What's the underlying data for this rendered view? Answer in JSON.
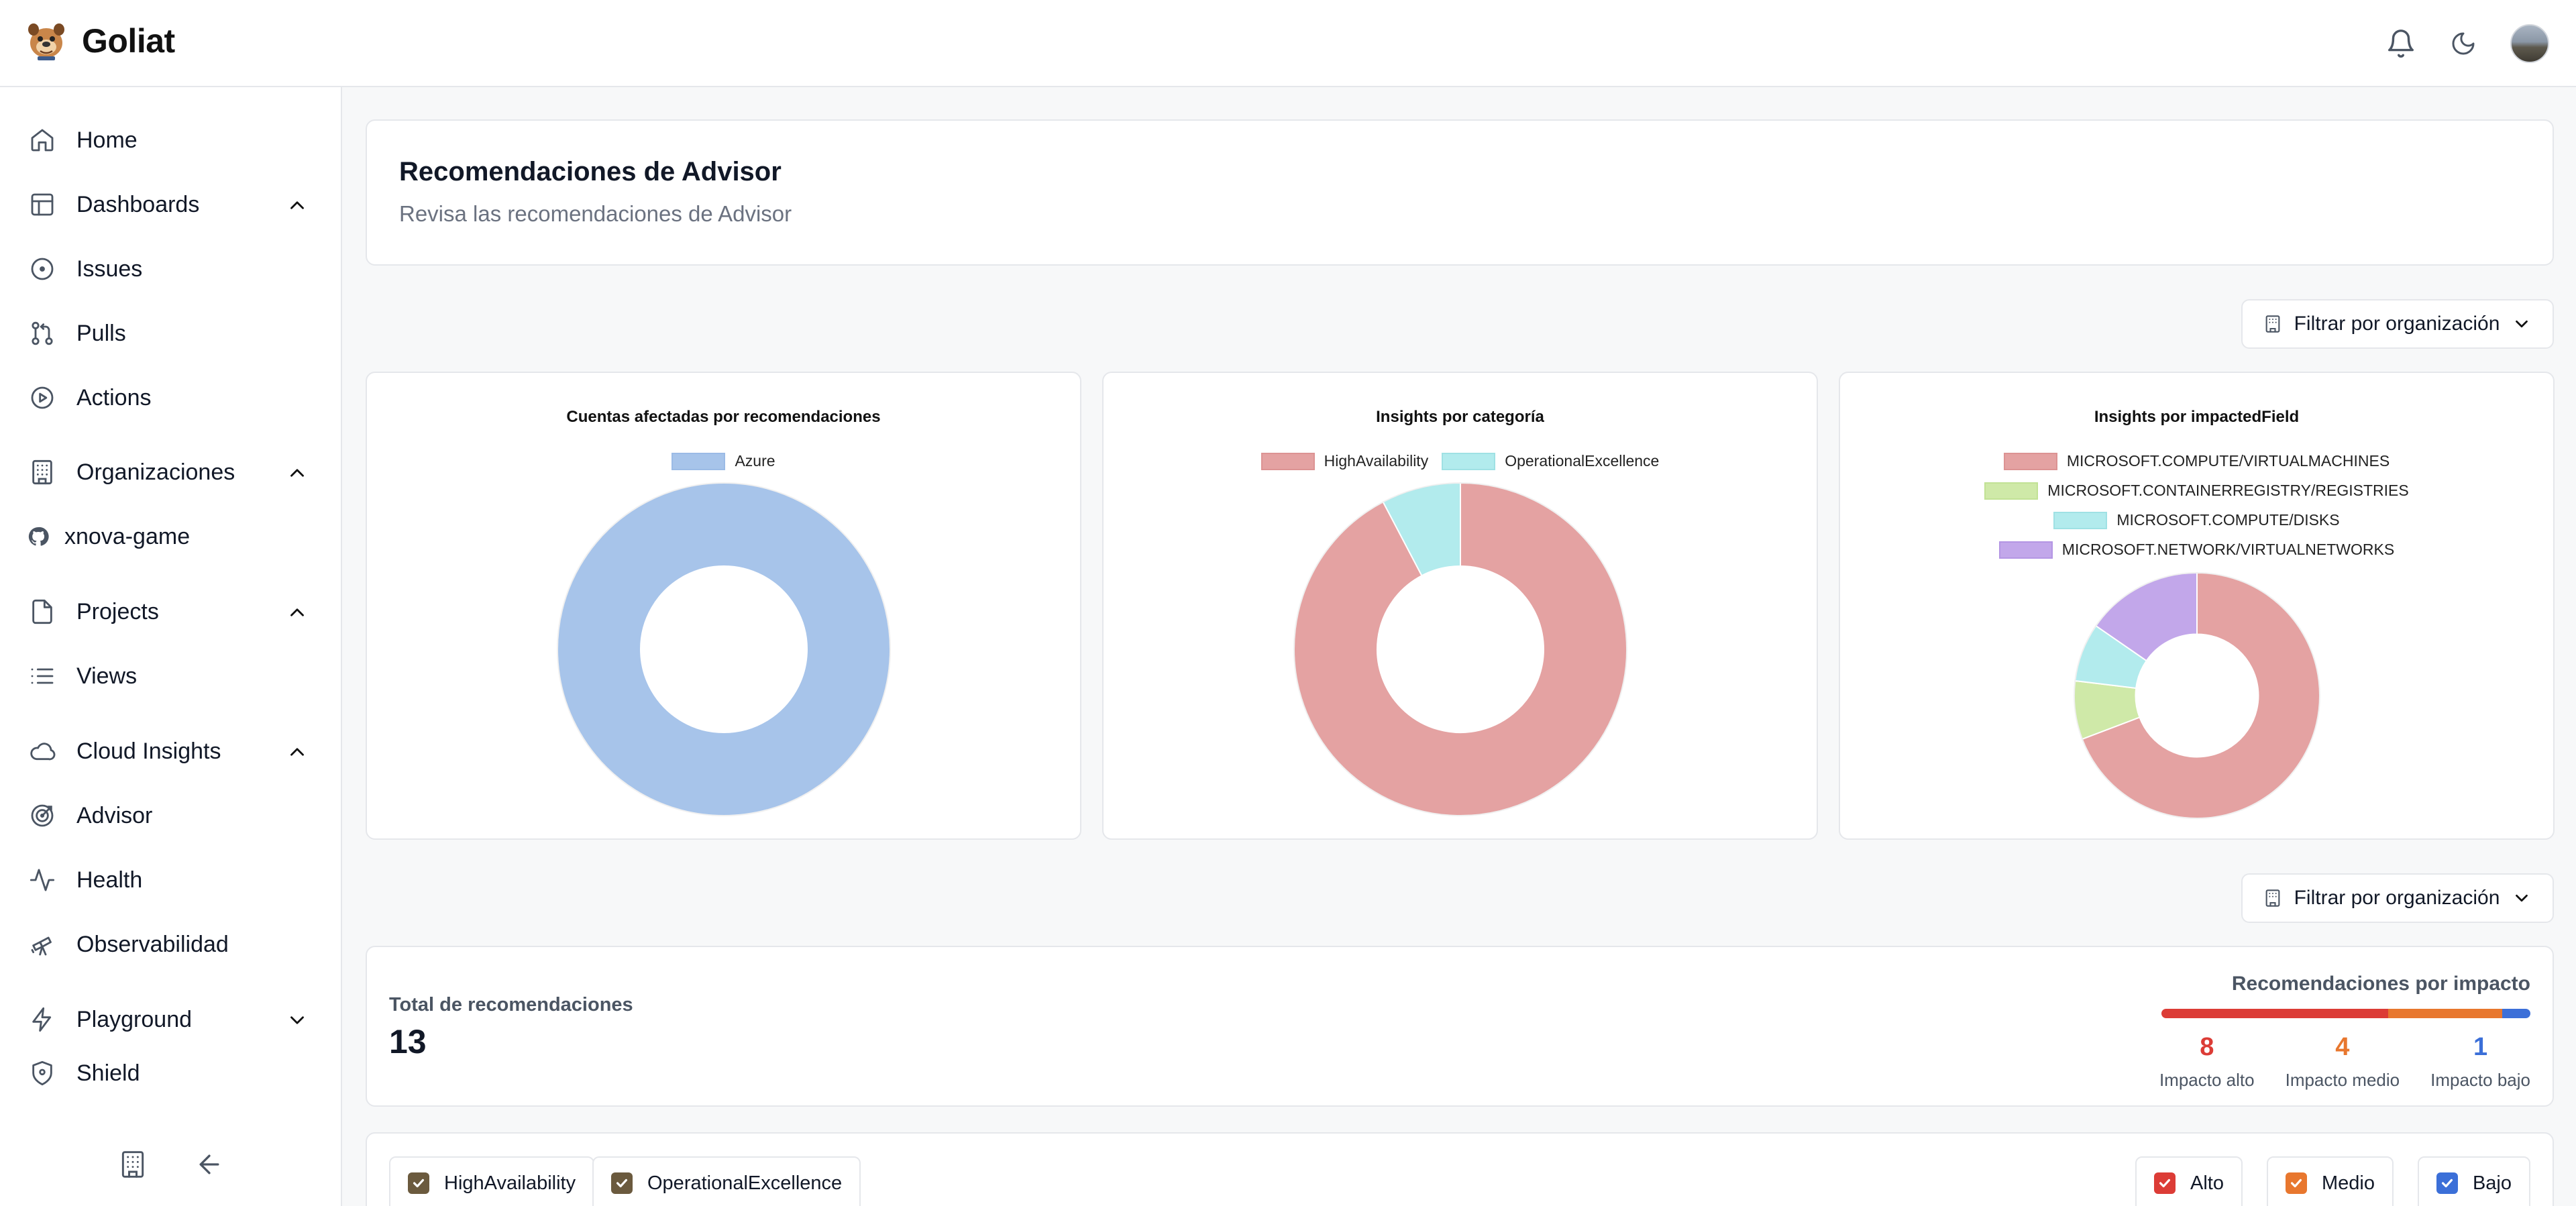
{
  "app": {
    "name": "Goliat"
  },
  "sidebar": {
    "items": [
      {
        "label": "Home",
        "icon": "home-icon"
      },
      {
        "label": "Dashboards",
        "icon": "table-layout-icon"
      },
      {
        "label": "Issues",
        "icon": "circle-dot-icon"
      },
      {
        "label": "Pulls",
        "icon": "git-pull-request-icon"
      },
      {
        "label": "Actions",
        "icon": "play-circle-icon"
      },
      {
        "label": "Organizaciones",
        "icon": "building-icon"
      },
      {
        "label": "xnova-game",
        "icon": "github-icon"
      },
      {
        "label": "Projects",
        "icon": "file-icon"
      },
      {
        "label": "Views",
        "icon": "list-icon"
      },
      {
        "label": "Cloud Insights",
        "icon": "cloud-icon"
      },
      {
        "label": "Advisor",
        "icon": "target-icon"
      },
      {
        "label": "Health",
        "icon": "activity-icon"
      },
      {
        "label": "Observabilidad",
        "icon": "telescope-icon"
      },
      {
        "label": "Playground",
        "icon": "zap-icon"
      },
      {
        "label": "Shield",
        "icon": "shield-icon"
      }
    ]
  },
  "header": {
    "title": "Recomendaciones de Advisor",
    "subtitle": "Revisa las recomendaciones de Advisor"
  },
  "filter": {
    "label": "Filtrar por organización"
  },
  "charts": {
    "cuentas": {
      "title": "Cuentas afectadas por recomendaciones",
      "legend": [
        "Azure"
      ]
    },
    "categoria": {
      "title": "Insights por categoría",
      "legend": [
        "HighAvailability",
        "OperationalExcellence"
      ]
    },
    "impacted": {
      "title": "Insights por impactedField",
      "legend": [
        "MICROSOFT.COMPUTE/VIRTUALMACHINES",
        "MICROSOFT.CONTAINERREGISTRY/REGISTRIES",
        "MICROSOFT.COMPUTE/DISKS",
        "MICROSOFT.NETWORK/VIRTUALNETWORKS"
      ]
    }
  },
  "chart_data": [
    {
      "type": "pie",
      "title": "Cuentas afectadas por recomendaciones",
      "categories": [
        "Azure"
      ],
      "values": [
        13
      ],
      "colors": [
        "#a7c4ea"
      ],
      "legend": "top"
    },
    {
      "type": "pie",
      "title": "Insights por categoría",
      "categories": [
        "HighAvailability",
        "OperationalExcellence"
      ],
      "values": [
        12,
        1
      ],
      "colors": [
        "#e4a2a2",
        "#b2ebed"
      ],
      "legend": "top"
    },
    {
      "type": "pie",
      "title": "Insights por impactedField",
      "categories": [
        "MICROSOFT.COMPUTE/VIRTUALMACHINES",
        "MICROSOFT.CONTAINERREGISTRY/REGISTRIES",
        "MICROSOFT.COMPUTE/DISKS",
        "MICROSOFT.NETWORK/VIRTUALNETWORKS"
      ],
      "values": [
        9,
        1,
        1,
        2
      ],
      "colors": [
        "#e4a2a2",
        "#cfe9a8",
        "#b2ebed",
        "#c2a7ea"
      ],
      "legend": "top"
    }
  ],
  "totals": {
    "label": "Total de recomendaciones",
    "value": "13"
  },
  "impact": {
    "title": "Recomendaciones por impacto",
    "items": [
      {
        "value": "8",
        "label": "Impacto alto",
        "color": "#dc3c36"
      },
      {
        "value": "4",
        "label": "Impacto medio",
        "color": "#e8772e"
      },
      {
        "value": "1",
        "label": "Impacto bajo",
        "color": "#3b6fd8"
      }
    ]
  },
  "category_filters": [
    "HighAvailability",
    "OperationalExcellence"
  ],
  "impact_filters": [
    {
      "label": "Alto",
      "color": "#dc3c36"
    },
    {
      "label": "Medio",
      "color": "#e8772e"
    },
    {
      "label": "Bajo",
      "color": "#3b6fd8"
    }
  ]
}
